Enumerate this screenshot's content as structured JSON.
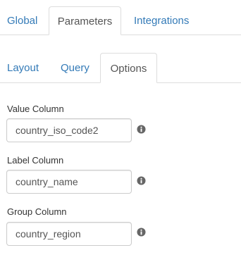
{
  "top_tabs": [
    {
      "label": "Global",
      "active": false
    },
    {
      "label": "Parameters",
      "active": true
    },
    {
      "label": "Integrations",
      "active": false
    }
  ],
  "sub_tabs": [
    {
      "label": "Layout",
      "active": false
    },
    {
      "label": "Query",
      "active": false
    },
    {
      "label": "Options",
      "active": true
    }
  ],
  "fields": [
    {
      "label": "Value Column",
      "value": "country_iso_code2",
      "info_icon": "info-circle-icon"
    },
    {
      "label": "Label Column",
      "value": "country_name",
      "info_icon": "info-circle-icon"
    },
    {
      "label": "Group Column",
      "value": "country_region",
      "info_icon": "info-circle-icon"
    }
  ],
  "colors": {
    "link": "#337ab7",
    "active_tab_text": "#555555",
    "border": "#dddddd",
    "icon": "#666666"
  }
}
